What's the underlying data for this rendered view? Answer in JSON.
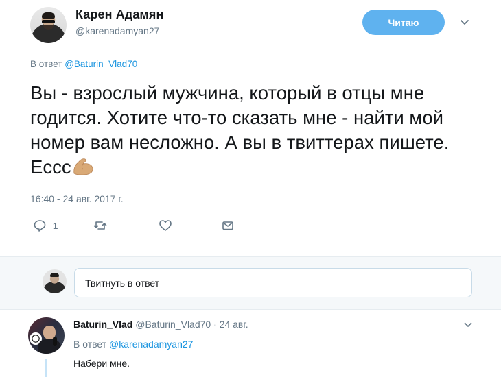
{
  "tweet": {
    "display_name": "Карен Адамян",
    "handle": "@karenadamyan27",
    "follow_label": "Читаю",
    "reply_prefix": "В ответ",
    "reply_to_handle": "@Baturin_Vlad70",
    "text": "Вы - взрослый мужчина, который в отцы мне годится. Хотите что-то сказать мне - найти мой номер вам несложно. А вы в твиттерах пишете. Еccc",
    "emoji_icon": "flexed-biceps-icon",
    "timestamp": "16:40 - 24 авг. 2017 г.",
    "actions": {
      "reply_count": "1",
      "icons": [
        "reply-icon",
        "retweet-icon",
        "like-icon",
        "direct-message-icon"
      ]
    }
  },
  "compose": {
    "placeholder": "Твитнуть в ответ"
  },
  "reply": {
    "name": "Baturin_Vlad",
    "handle": "@Baturin_Vlad70",
    "separator": "·",
    "date": "24 авг.",
    "reply_prefix": "В ответ",
    "reply_to_handle": "@karenadamyan27",
    "text": "Набери мне."
  },
  "colors": {
    "accent": "#1b95e0",
    "follow_button": "#5fb2ef",
    "muted": "#657786",
    "text": "#14171a"
  }
}
